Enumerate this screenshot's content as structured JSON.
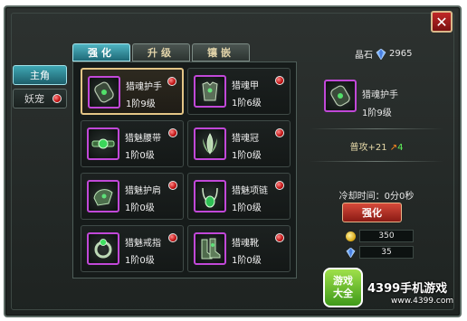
{
  "close_label": "✕",
  "side_tabs": [
    {
      "label": "主角",
      "active": true
    },
    {
      "label": "妖宠",
      "active": false,
      "badge": true
    }
  ],
  "top_tabs": [
    {
      "label": "强化",
      "active": true
    },
    {
      "label": "升级",
      "active": false
    },
    {
      "label": "镶嵌",
      "active": false
    }
  ],
  "currency": {
    "label": "晶石",
    "value": "2965"
  },
  "equipment": [
    {
      "name": "猎魂护手",
      "level": "1阶9级",
      "icon": "gauntlet-icon",
      "selected": true
    },
    {
      "name": "猎魂甲",
      "level": "1阶6级",
      "icon": "armor-icon",
      "selected": false
    },
    {
      "name": "猎魅腰带",
      "level": "1阶0级",
      "icon": "belt-icon",
      "selected": false
    },
    {
      "name": "猎魂冠",
      "level": "1阶0级",
      "icon": "crown-icon",
      "selected": false
    },
    {
      "name": "猎魅护肩",
      "level": "1阶0级",
      "icon": "shoulder-icon",
      "selected": false
    },
    {
      "name": "猎魅项链",
      "level": "1阶0级",
      "icon": "necklace-icon",
      "selected": false
    },
    {
      "name": "猎魅戒指",
      "level": "1阶0级",
      "icon": "ring-icon",
      "selected": false
    },
    {
      "name": "猎魂靴",
      "level": "1阶0级",
      "icon": "boots-icon",
      "selected": false
    }
  ],
  "detail": {
    "name": "猎魂护手",
    "level": "1阶9级",
    "stat_text": "普攻+21",
    "stat_increase": "4",
    "cooldown": "冷却时间：0分0秒",
    "upgrade_label": "强化",
    "cost_gold": "350",
    "cost_crystal": "35"
  },
  "watermark": {
    "logo_line1": "游戏",
    "logo_line2": "大全",
    "text": "4399手机游戏",
    "url": "www.4399.com"
  },
  "colors": {
    "accent_cyan": "#3fa7b4",
    "slot_border": "#c148d8",
    "red_button": "#d64a3a"
  }
}
